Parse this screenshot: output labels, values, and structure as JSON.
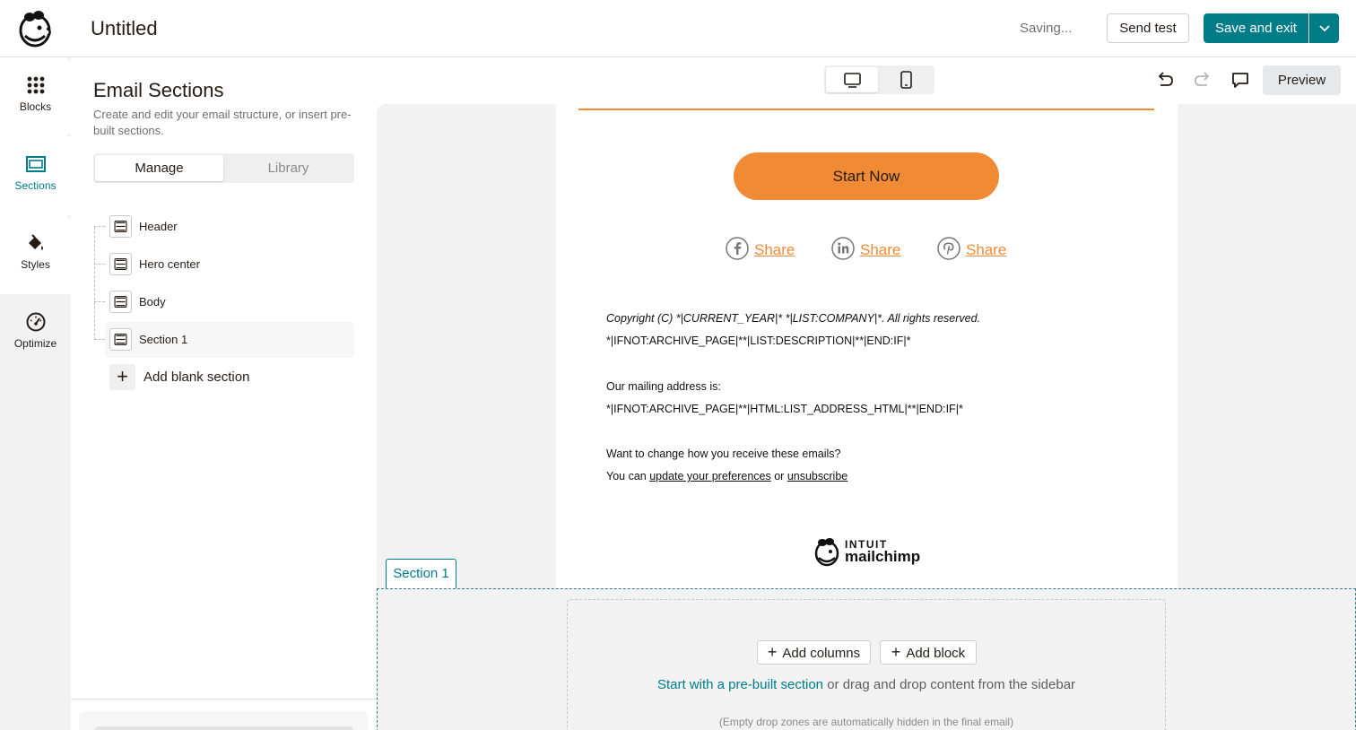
{
  "topbar": {
    "title": "Untitled",
    "status": "Saving...",
    "send_test": "Send test",
    "save_exit": "Save and exit"
  },
  "rail": {
    "items": [
      {
        "label": "Blocks",
        "icon": "grid-dots-icon"
      },
      {
        "label": "Sections",
        "icon": "sections-icon"
      },
      {
        "label": "Styles",
        "icon": "paint-bucket-icon"
      },
      {
        "label": "Optimize",
        "icon": "gauge-icon"
      }
    ],
    "active": "Sections"
  },
  "panel": {
    "title": "Email Sections",
    "description": "Create and edit your email structure, or insert pre-built sections.",
    "tabs": {
      "manage": "Manage",
      "library": "Library"
    },
    "sections": [
      {
        "label": "Header"
      },
      {
        "label": "Hero center"
      },
      {
        "label": "Body"
      },
      {
        "label": "Section 1"
      }
    ],
    "add_blank": "Add blank section"
  },
  "toolbar": {
    "preview": "Preview"
  },
  "email": {
    "cta": "Start Now",
    "shares": [
      {
        "network": "facebook",
        "label": "Share"
      },
      {
        "network": "linkedin",
        "label": "Share"
      },
      {
        "network": "pinterest",
        "label": "Share"
      }
    ],
    "copyright": "Copyright (C) *|CURRENT_YEAR|* *|LIST:COMPANY|*. All rights reserved.",
    "archive_desc": "*|IFNOT:ARCHIVE_PAGE|**|LIST:DESCRIPTION|**|END:IF|*",
    "mailing_label": "Our mailing address is:",
    "address": "*|IFNOT:ARCHIVE_PAGE|**|HTML:LIST_ADDRESS_HTML|**|END:IF|*",
    "change_q": "Want to change how you receive these emails?",
    "you_can": "You can",
    "update_prefs": "update your preferences",
    "or": "or",
    "unsubscribe": "unsubscribe",
    "logo_line1": "INTUIT",
    "logo_line2": "mailchimp"
  },
  "dropzone": {
    "section_tag": "Section 1",
    "add_columns": "Add columns",
    "add_block": "Add block",
    "hint_link": "Start with a pre-built section",
    "hint_rest": " or drag and drop content from the sidebar",
    "note": "(Empty drop zones are automatically hidden in the final email)"
  },
  "colors": {
    "brand_teal": "#007c89",
    "cta_orange": "#f08a35"
  }
}
